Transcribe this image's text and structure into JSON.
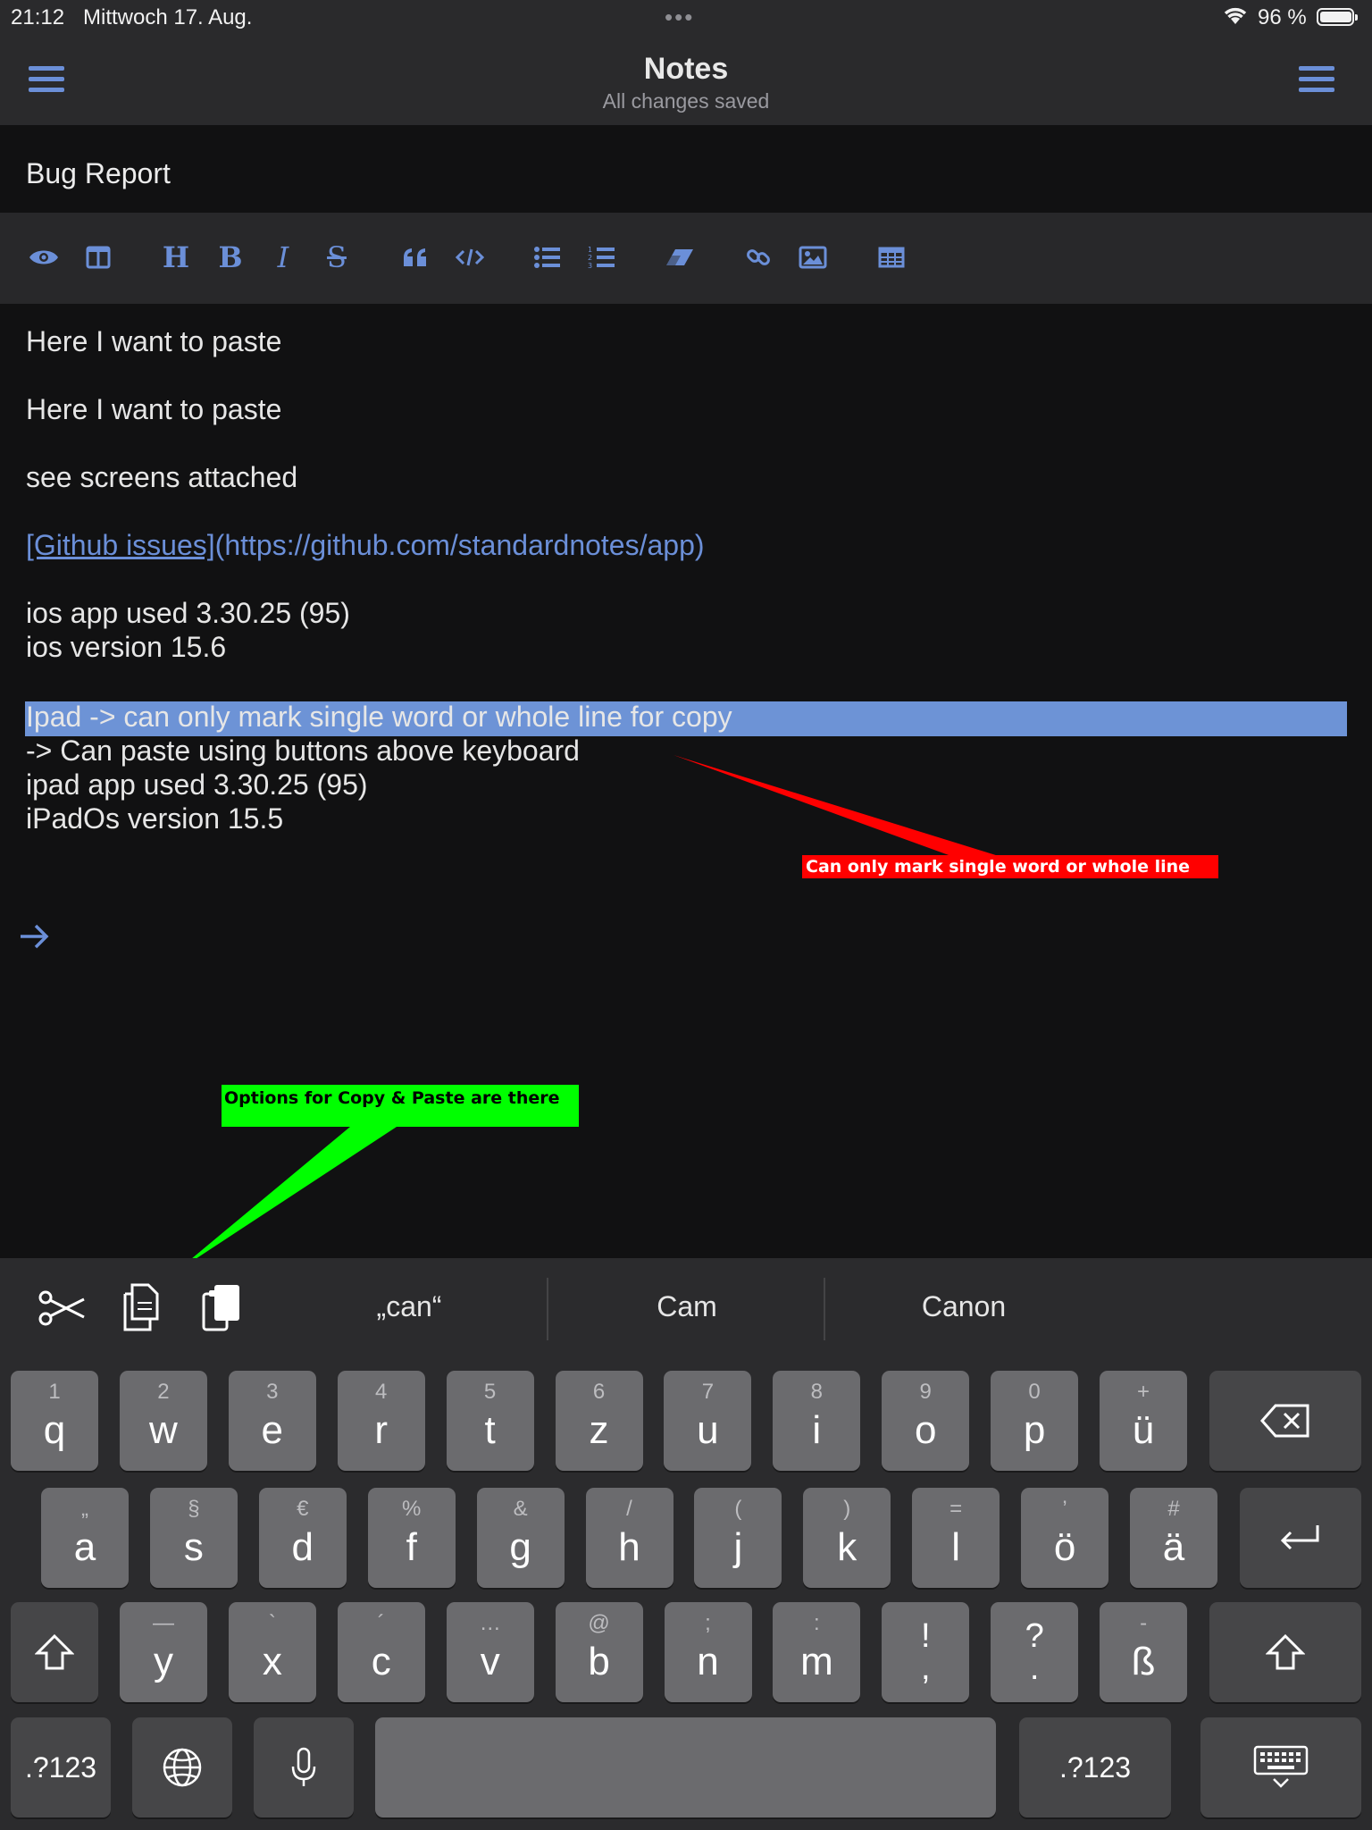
{
  "status_bar": {
    "time": "21:12",
    "date": "Mittwoch 17. Aug.",
    "battery_pct": "96 %",
    "battery_level": 0.96
  },
  "nav": {
    "title": "Notes",
    "subtitle": "All changes saved"
  },
  "note": {
    "title": "Bug Report"
  },
  "toolbar": {
    "icons": [
      "preview-eye-icon",
      "split-view-icon",
      "heading-icon",
      "bold-icon",
      "italic-icon",
      "strikethrough-icon",
      "quote-icon",
      "code-icon",
      "bullet-list-icon",
      "numbered-list-icon",
      "eraser-icon",
      "link-icon",
      "image-icon",
      "table-icon"
    ],
    "heading_glyph": "H",
    "bold_glyph": "B",
    "italic_glyph": "I",
    "strike_glyph": "S"
  },
  "editor": {
    "line1": "Here I want to paste",
    "line2": "Here I want to paste",
    "line3": "see screens attached",
    "link_text": "[Github issues]",
    "link_url": "(https://github.com/standardnotes/app)",
    "line5": "ios app used 3.30.25 (95)",
    "line6": "ios version 15.6",
    "selected_line": "Ipad -> can only mark single word or whole line for copy",
    "line8": "-> Can paste using buttons above keyboard",
    "line9": "ipad app used 3.30.25 (95)",
    "line10": "iPadOs version 15.5"
  },
  "annotations": {
    "red": "Can only mark single word or whole line",
    "green": "Options for Copy & Paste are there",
    "red_color": "#ff0000",
    "green_color": "#00ff00"
  },
  "keyboard": {
    "shortcuts": [
      "cut-icon",
      "copy-icon",
      "paste-icon"
    ],
    "suggestions": [
      "„can“",
      "Cam",
      "Canon"
    ],
    "row1": [
      {
        "sub": "1",
        "main": "q"
      },
      {
        "sub": "2",
        "main": "w"
      },
      {
        "sub": "3",
        "main": "e"
      },
      {
        "sub": "4",
        "main": "r"
      },
      {
        "sub": "5",
        "main": "t"
      },
      {
        "sub": "6",
        "main": "z"
      },
      {
        "sub": "7",
        "main": "u"
      },
      {
        "sub": "8",
        "main": "i"
      },
      {
        "sub": "9",
        "main": "o"
      },
      {
        "sub": "0",
        "main": "p"
      },
      {
        "sub": "+",
        "main": "ü"
      }
    ],
    "row2": [
      {
        "sub": "„",
        "main": "a"
      },
      {
        "sub": "§",
        "main": "s"
      },
      {
        "sub": "€",
        "main": "d"
      },
      {
        "sub": "%",
        "main": "f"
      },
      {
        "sub": "&",
        "main": "g"
      },
      {
        "sub": "/",
        "main": "h"
      },
      {
        "sub": "(",
        "main": "j"
      },
      {
        "sub": ")",
        "main": "k"
      },
      {
        "sub": "=",
        "main": "l"
      },
      {
        "sub": "’",
        "main": "ö"
      },
      {
        "sub": "#",
        "main": "ä"
      }
    ],
    "row3": [
      {
        "sub": "—",
        "main": "y"
      },
      {
        "sub": "`",
        "main": "x"
      },
      {
        "sub": "´",
        "main": "c"
      },
      {
        "sub": "…",
        "main": "v"
      },
      {
        "sub": "@",
        "main": "b"
      },
      {
        "sub": ";",
        "main": "n"
      },
      {
        "sub": ":",
        "main": "m"
      }
    ],
    "row3_stack": [
      {
        "top": "!",
        "bottom": ","
      },
      {
        "top": "?",
        "bottom": "."
      }
    ],
    "eszett": {
      "sub": "-",
      "main": "ß"
    },
    "numbers_label": ".?123",
    "numbers_label_right": ".?123"
  }
}
